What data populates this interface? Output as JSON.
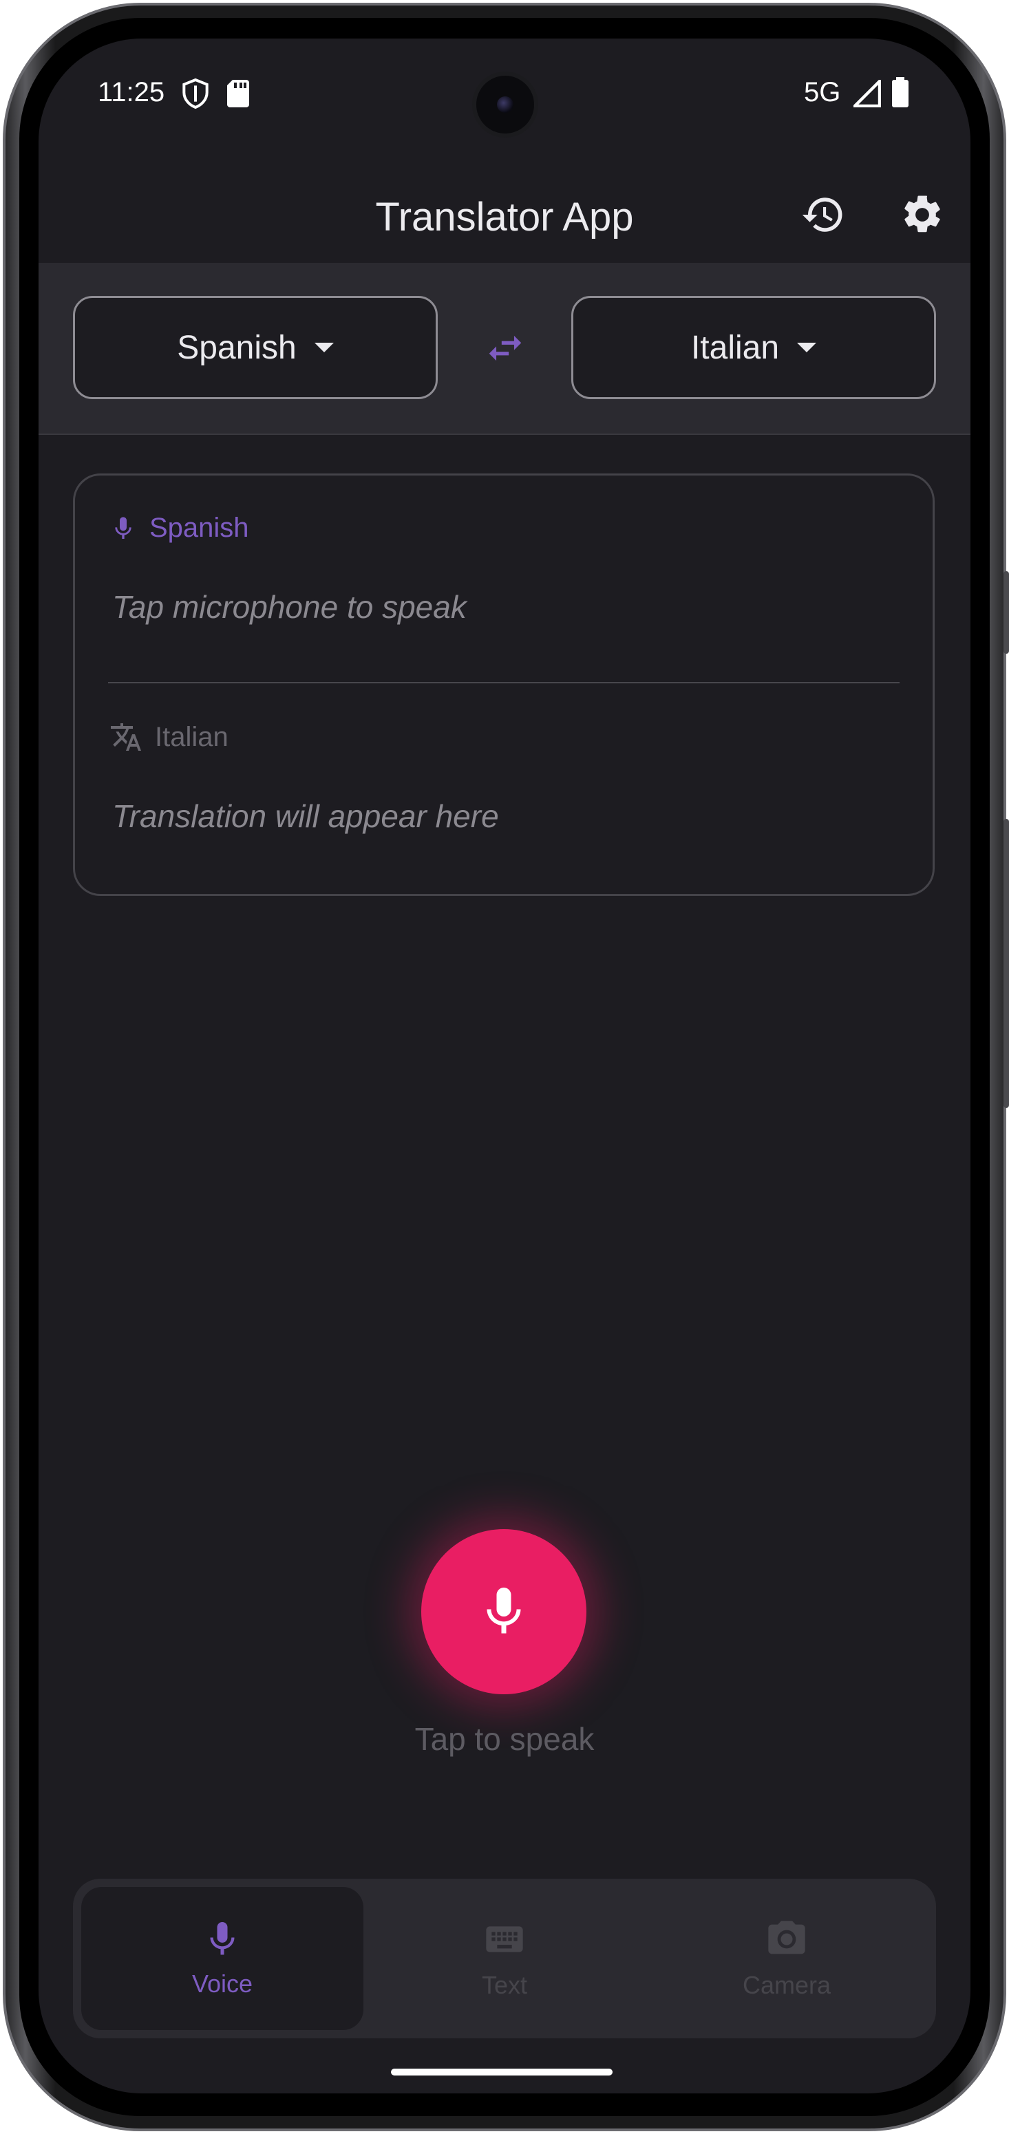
{
  "status_bar": {
    "time": "11:25",
    "network": "5G",
    "icons": [
      "vpn-shield-icon",
      "sd-card-icon",
      "signal-icon",
      "battery-icon"
    ]
  },
  "app_bar": {
    "title": "Translator App",
    "icons": [
      "history-icon",
      "settings-icon"
    ]
  },
  "language_bar": {
    "source_language": "Spanish",
    "target_language": "Italian",
    "swap_icon": "swap-icon"
  },
  "card": {
    "source": {
      "label": "Spanish",
      "placeholder": "Tap microphone to speak",
      "icon": "mic-icon"
    },
    "target": {
      "label": "Italian",
      "placeholder": "Translation will appear here",
      "icon": "translate-icon"
    }
  },
  "mic_button": {
    "hint": "Tap to speak"
  },
  "bottom_nav": {
    "items": [
      {
        "label": "Voice",
        "icon": "mic-icon",
        "active": true
      },
      {
        "label": "Text",
        "icon": "keyboard-icon",
        "active": false
      },
      {
        "label": "Camera",
        "icon": "camera-icon",
        "active": false
      }
    ]
  },
  "colors": {
    "accent": "#7e5cc2",
    "mic": "#e91e63",
    "background": "#1d1c21",
    "surface": "#2b2a30"
  }
}
